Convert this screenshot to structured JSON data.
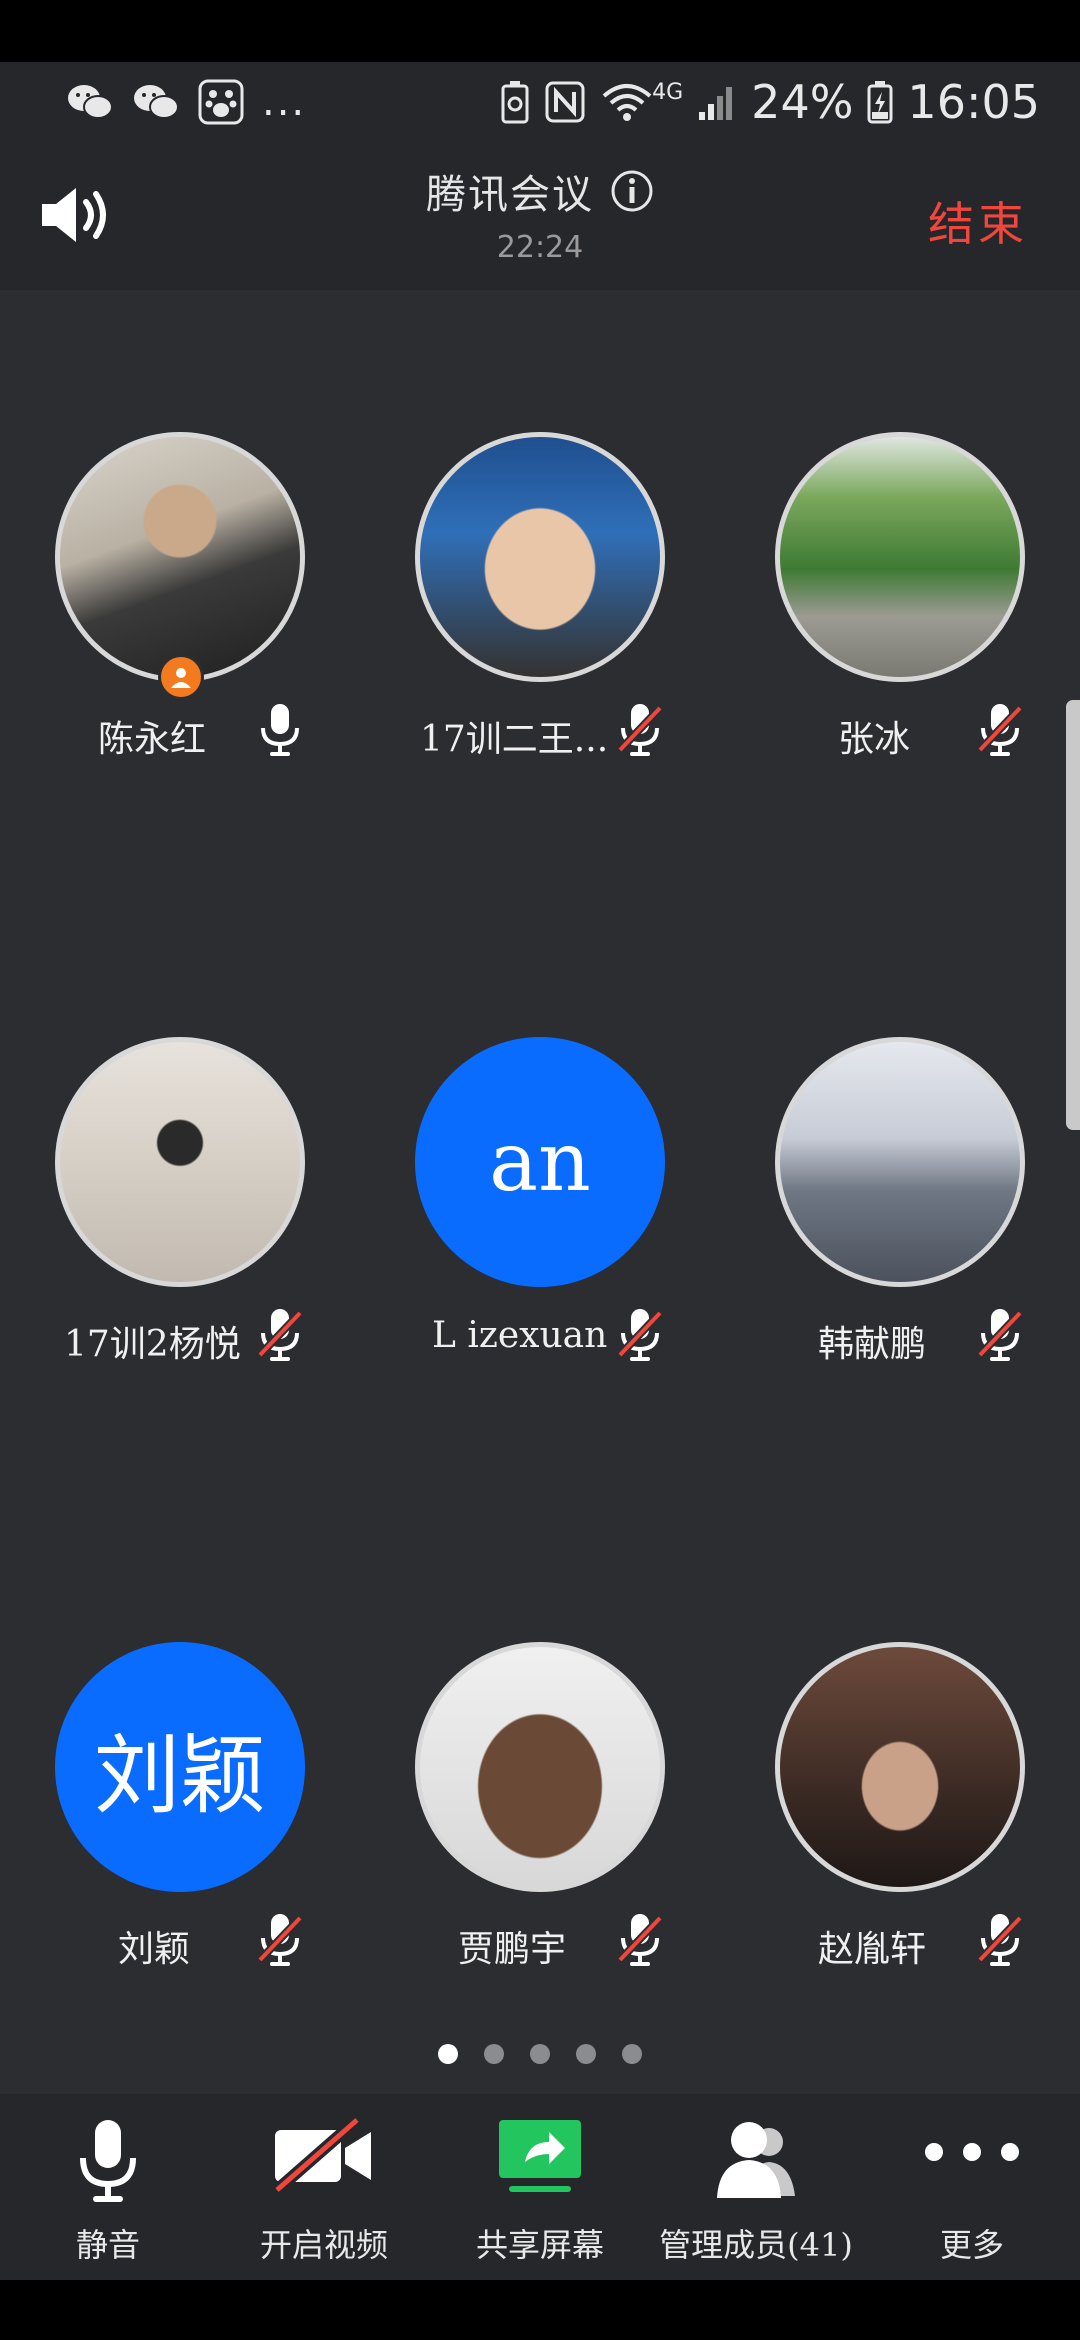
{
  "status_bar": {
    "icons_left": [
      "wechat-icon",
      "wechat-icon",
      "baidu-paw-icon"
    ],
    "overflow": "...",
    "network": "4G",
    "battery": "24%",
    "time": "16:05"
  },
  "header": {
    "title": "腾讯会议",
    "timer": "22:24",
    "end_label": "结束"
  },
  "participants": [
    {
      "name": "陈永红",
      "muted": false,
      "host": true,
      "avatar": "photo"
    },
    {
      "name": "17训二王...",
      "muted": true,
      "host": false,
      "avatar": "photo"
    },
    {
      "name": "张冰",
      "muted": true,
      "host": false,
      "avatar": "photo"
    },
    {
      "name": "17训2杨悦",
      "muted": true,
      "host": false,
      "avatar": "photo"
    },
    {
      "name": "L izexuan",
      "muted": true,
      "host": false,
      "avatar": "initials",
      "initials": "an"
    },
    {
      "name": "韩献鹏",
      "muted": true,
      "host": false,
      "avatar": "photo"
    },
    {
      "name": "刘颖",
      "muted": true,
      "host": false,
      "avatar": "initials",
      "initials": "刘颖"
    },
    {
      "name": "贾鹏宇",
      "muted": true,
      "host": false,
      "avatar": "photo"
    },
    {
      "name": "赵胤轩",
      "muted": true,
      "host": false,
      "avatar": "photo"
    }
  ],
  "pagination": {
    "pages": 5,
    "current": 1
  },
  "toolbar": {
    "mute_label": "静音",
    "video_label": "开启视频",
    "share_label": "共享屏幕",
    "members_label": "管理成员(41)",
    "more_label": "更多"
  },
  "colors": {
    "background": "#2b2d31",
    "bar": "#25272b",
    "end_red": "#f0463c",
    "avatar_blue": "#0a6cff",
    "host_orange": "#f47a1f",
    "share_green": "#22c55e"
  }
}
